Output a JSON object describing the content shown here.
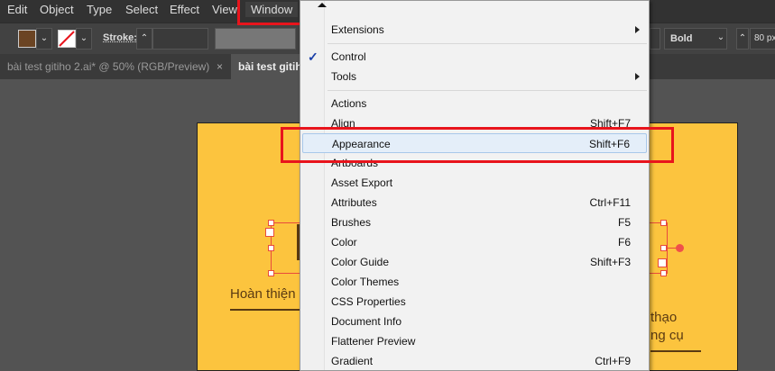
{
  "menubar": {
    "items": [
      "Edit",
      "Object",
      "Type",
      "Select",
      "Effect",
      "View",
      "Window"
    ]
  },
  "control": {
    "stroke_label": "Stroke:",
    "font_style": "Bold",
    "font_size": "80 px",
    "fill_color": "#6b4423"
  },
  "tabs": [
    {
      "label": "bài test gitiho 2.ai* @ 50% (RGB/Preview)",
      "close": "×"
    },
    {
      "label": "bài test gitiho"
    }
  ],
  "artboard": {
    "text_left": "Hoàn thiện",
    "text_right_1": "thạo",
    "text_right_2": "ng cụ",
    "bg": "#fcc43e"
  },
  "window_menu": {
    "items": [
      {
        "label": "Extensions",
        "submenu": true
      },
      {
        "sep": true
      },
      {
        "label": "Control",
        "checked": true,
        "check": "✓"
      },
      {
        "label": "Tools",
        "submenu": true
      },
      {
        "sep": true
      },
      {
        "label": "Actions"
      },
      {
        "label": "Align",
        "shortcut": "Shift+F7"
      },
      {
        "label": "Appearance",
        "shortcut": "Shift+F6",
        "highlighted": true
      },
      {
        "label": "Artboards"
      },
      {
        "label": "Asset Export"
      },
      {
        "label": "Attributes",
        "shortcut": "Ctrl+F11"
      },
      {
        "label": "Brushes",
        "shortcut": "F5"
      },
      {
        "label": "Color",
        "shortcut": "F6"
      },
      {
        "label": "Color Guide",
        "shortcut": "Shift+F3"
      },
      {
        "label": "Color Themes"
      },
      {
        "label": "CSS Properties"
      },
      {
        "label": "Document Info"
      },
      {
        "label": "Flattener Preview"
      },
      {
        "label": "Gradient",
        "shortcut": "Ctrl+F9"
      }
    ]
  }
}
